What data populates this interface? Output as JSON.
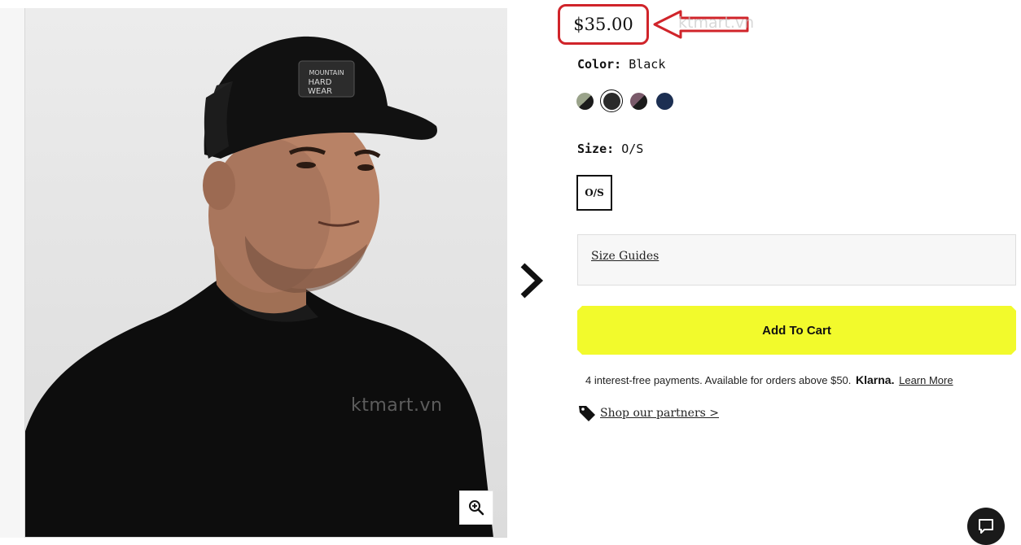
{
  "product": {
    "price": "$35.00",
    "color_label": "Color:",
    "color_value": "Black",
    "size_label": "Size:",
    "size_value": "O/S",
    "size_options": [
      "O/S"
    ],
    "colors": [
      {
        "name": "olive-black",
        "colors": [
          "#9aa38a",
          "#1b1b1b"
        ],
        "selected": false
      },
      {
        "name": "black",
        "colors": [
          "#2a2a2a",
          "#2a2a2a"
        ],
        "selected": true
      },
      {
        "name": "plum-black",
        "colors": [
          "#7a5a6a",
          "#1b1b1b"
        ],
        "selected": false
      },
      {
        "name": "navy",
        "colors": [
          "#1c2f52",
          "#1c2f52"
        ],
        "selected": false
      }
    ]
  },
  "links": {
    "size_guides": "Size Guides",
    "shop_partners": "Shop our partners >",
    "learn_more": "Learn More"
  },
  "cart": {
    "add_to_cart": "Add To Cart"
  },
  "klarna": {
    "text": "4 interest-free payments. Available for orders above $50.",
    "brand": "Klarna."
  },
  "watermark": {
    "top": "ktmart.vn",
    "photo": "ktmart.vn"
  },
  "image": {
    "cap_logo": "MOUNTAIN HARD WEAR"
  },
  "colors": {
    "accent_yellow": "#f2fa2c",
    "annotation_red": "#d0242a",
    "chat_bg": "#1a1a1a"
  },
  "icons": {
    "zoom": "zoom-in-icon",
    "next": "chevron-right-icon",
    "tag": "tag-icon",
    "chat": "chat-icon"
  }
}
